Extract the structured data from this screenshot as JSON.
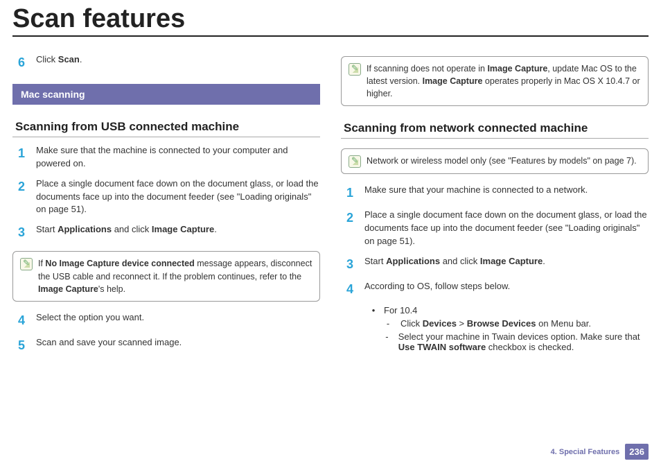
{
  "title": "Scan features",
  "left": {
    "step6": {
      "num": "6",
      "text_pre": "Click ",
      "bold": "Scan",
      "text_post": "."
    },
    "sectionBar": "Mac scanning",
    "subheading": "Scanning from USB connected machine",
    "steps": [
      {
        "num": "1",
        "text": "Make sure that the machine is connected to your computer and powered on."
      },
      {
        "num": "2",
        "text": "Place a single document face down on the document glass, or load the documents face up into the document feeder (see \"Loading originals\" on page 51)."
      },
      {
        "num": "3",
        "pre": "Start ",
        "b1": "Applications",
        "mid": " and click ",
        "b2": "Image Capture",
        "post": "."
      }
    ],
    "note": {
      "pre": "If ",
      "b1": "No Image Capture device connected",
      "mid": " message appears, disconnect the USB cable and reconnect it. If the problem continues, refer to the ",
      "b2": "Image Capture",
      "post": "'s help."
    },
    "steps2": [
      {
        "num": "4",
        "text": "Select the option you want."
      },
      {
        "num": "5",
        "text": "Scan and save your scanned image."
      }
    ]
  },
  "right": {
    "note1": {
      "pre": "If scanning does not operate in ",
      "b1": "Image Capture",
      "mid": ", update Mac OS to the latest version. ",
      "b2": "Image Capture",
      "post": " operates properly in Mac OS X 10.4.7 or higher."
    },
    "subheading": "Scanning from network connected machine",
    "note2": {
      "text": "Network or wireless model only (see \"Features by models\" on page 7)."
    },
    "steps": [
      {
        "num": "1",
        "text": "Make sure that your machine is connected to a network."
      },
      {
        "num": "2",
        "text": "Place a single document face down on the document glass, or load the documents face up into the document feeder (see \"Loading originals\" on page 51)."
      },
      {
        "num": "3",
        "pre": "Start ",
        "b1": "Applications",
        "mid": " and click ",
        "b2": "Image Capture",
        "post": "."
      },
      {
        "num": "4",
        "text": " According to OS, follow steps below."
      }
    ],
    "bullets": {
      "l1": "For 10.4",
      "d1_pre": "Click ",
      "d1_b1": "Devices",
      "d1_mid": " > ",
      "d1_b2": "Browse Devices",
      "d1_post": " on Menu bar.",
      "d2_pre": "Select your machine in Twain devices option. Make sure that ",
      "d2_b": "Use TWAIN software",
      "d2_post": " checkbox is checked."
    }
  },
  "footer": {
    "chapter": "4.  Special Features",
    "page": "236"
  }
}
